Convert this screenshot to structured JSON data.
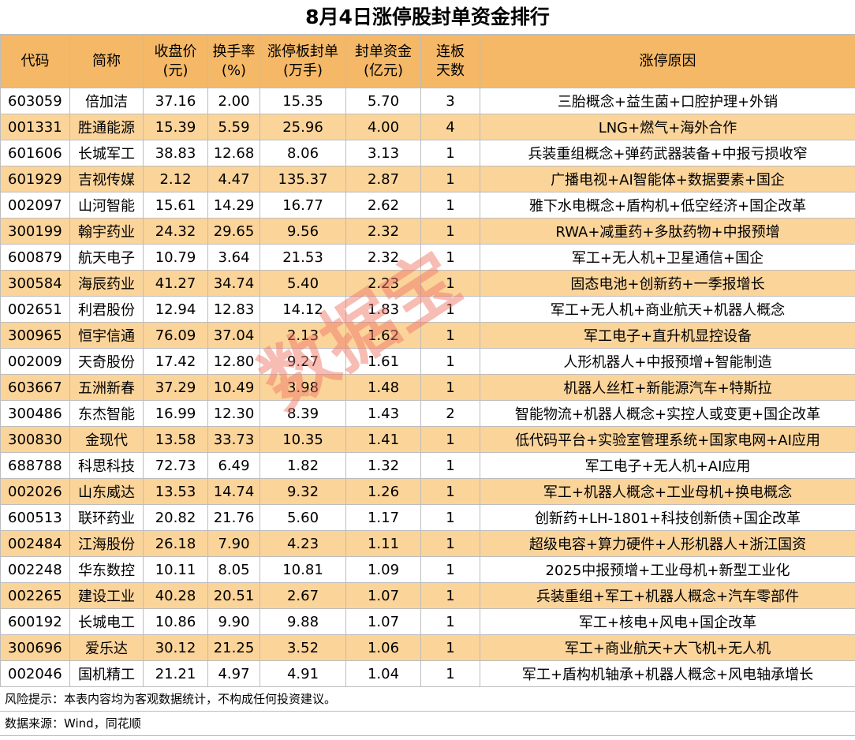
{
  "title": "8月4日涨停股封单资金排行",
  "headers": {
    "code": "代码",
    "name": "简称",
    "close_1": "收盘价",
    "close_2": "(元)",
    "turnover_1": "换手率",
    "turnover_2": "(%)",
    "seal_1": "涨停板封单",
    "seal_2": "(万手)",
    "fund_1": "封单资金",
    "fund_2": "(亿元)",
    "days_1": "连板",
    "days_2": "天数",
    "reason": "涨停原因"
  },
  "rows": [
    {
      "code": "603059",
      "name": "倍加洁",
      "close": "37.16",
      "turnover": "2.00",
      "seal": "15.35",
      "fund": "5.70",
      "days": "3",
      "reason": "三胎概念+益生菌+口腔护理+外销"
    },
    {
      "code": "001331",
      "name": "胜通能源",
      "close": "15.39",
      "turnover": "5.59",
      "seal": "25.96",
      "fund": "4.00",
      "days": "4",
      "reason": "LNG+燃气+海外合作"
    },
    {
      "code": "601606",
      "name": "长城军工",
      "close": "38.83",
      "turnover": "12.68",
      "seal": "8.06",
      "fund": "3.13",
      "days": "1",
      "reason": "兵装重组概念+弹药武器装备+中报亏损收窄"
    },
    {
      "code": "601929",
      "name": "吉视传媒",
      "close": "2.12",
      "turnover": "4.47",
      "seal": "135.37",
      "fund": "2.87",
      "days": "1",
      "reason": "广播电视+AI智能体+数据要素+国企"
    },
    {
      "code": "002097",
      "name": "山河智能",
      "close": "15.61",
      "turnover": "14.29",
      "seal": "16.77",
      "fund": "2.62",
      "days": "1",
      "reason": "雅下水电概念+盾构机+低空经济+国企改革"
    },
    {
      "code": "300199",
      "name": "翰宇药业",
      "close": "24.32",
      "turnover": "29.65",
      "seal": "9.56",
      "fund": "2.32",
      "days": "1",
      "reason": "RWA+减重药+多肽药物+中报预增"
    },
    {
      "code": "600879",
      "name": "航天电子",
      "close": "10.79",
      "turnover": "3.64",
      "seal": "21.53",
      "fund": "2.32",
      "days": "1",
      "reason": "军工+无人机+卫星通信+国企"
    },
    {
      "code": "300584",
      "name": "海辰药业",
      "close": "41.27",
      "turnover": "34.74",
      "seal": "5.40",
      "fund": "2.23",
      "days": "1",
      "reason": "固态电池+创新药+一季报增长"
    },
    {
      "code": "002651",
      "name": "利君股份",
      "close": "12.94",
      "turnover": "12.83",
      "seal": "14.12",
      "fund": "1.83",
      "days": "1",
      "reason": "军工+无人机+商业航天+机器人概念"
    },
    {
      "code": "300965",
      "name": "恒宇信通",
      "close": "76.09",
      "turnover": "37.04",
      "seal": "2.13",
      "fund": "1.62",
      "days": "1",
      "reason": "军工电子+直升机显控设备"
    },
    {
      "code": "002009",
      "name": "天奇股份",
      "close": "17.42",
      "turnover": "12.80",
      "seal": "9.27",
      "fund": "1.61",
      "days": "1",
      "reason": "人形机器人+中报预增+智能制造"
    },
    {
      "code": "603667",
      "name": "五洲新春",
      "close": "37.29",
      "turnover": "10.49",
      "seal": "3.98",
      "fund": "1.48",
      "days": "1",
      "reason": "机器人丝杠+新能源汽车+特斯拉"
    },
    {
      "code": "300486",
      "name": "东杰智能",
      "close": "16.99",
      "turnover": "12.30",
      "seal": "8.39",
      "fund": "1.43",
      "days": "2",
      "reason": "智能物流+机器人概念+实控人或变更+国企改革"
    },
    {
      "code": "300830",
      "name": "金现代",
      "close": "13.58",
      "turnover": "33.73",
      "seal": "10.35",
      "fund": "1.41",
      "days": "1",
      "reason": "低代码平台+实验室管理系统+国家电网+AI应用"
    },
    {
      "code": "688788",
      "name": "科思科技",
      "close": "72.73",
      "turnover": "6.49",
      "seal": "1.82",
      "fund": "1.32",
      "days": "1",
      "reason": "军工电子+无人机+AI应用"
    },
    {
      "code": "002026",
      "name": "山东威达",
      "close": "13.53",
      "turnover": "14.74",
      "seal": "9.32",
      "fund": "1.26",
      "days": "1",
      "reason": "军工+机器人概念+工业母机+换电概念"
    },
    {
      "code": "600513",
      "name": "联环药业",
      "close": "20.82",
      "turnover": "21.76",
      "seal": "5.60",
      "fund": "1.17",
      "days": "1",
      "reason": "创新药+LH-1801+科技创新债+国企改革"
    },
    {
      "code": "002484",
      "name": "江海股份",
      "close": "26.18",
      "turnover": "7.90",
      "seal": "4.23",
      "fund": "1.11",
      "days": "1",
      "reason": "超级电容+算力硬件+人形机器人+浙江国资"
    },
    {
      "code": "002248",
      "name": "华东数控",
      "close": "10.11",
      "turnover": "8.05",
      "seal": "10.81",
      "fund": "1.09",
      "days": "1",
      "reason": "2025中报预增+工业母机+新型工业化"
    },
    {
      "code": "002265",
      "name": "建设工业",
      "close": "40.28",
      "turnover": "20.51",
      "seal": "2.67",
      "fund": "1.07",
      "days": "1",
      "reason": "兵装重组+军工+机器人概念+汽车零部件"
    },
    {
      "code": "600192",
      "name": "长城电工",
      "close": "10.86",
      "turnover": "9.90",
      "seal": "9.88",
      "fund": "1.07",
      "days": "1",
      "reason": "军工+核电+风电+国企改革"
    },
    {
      "code": "300696",
      "name": "爱乐达",
      "close": "30.12",
      "turnover": "21.25",
      "seal": "3.52",
      "fund": "1.06",
      "days": "1",
      "reason": "军工+商业航天+大飞机+无人机"
    },
    {
      "code": "002046",
      "name": "国机精工",
      "close": "21.21",
      "turnover": "4.97",
      "seal": "4.91",
      "fund": "1.04",
      "days": "1",
      "reason": "军工+盾构机轴承+机器人概念+风电轴承增长"
    }
  ],
  "footer": {
    "risk": "风险提示：本表内容均为客观数据统计，不构成任何投资建议。",
    "source": "数据来源：Wind，同花顺"
  },
  "watermark": "数据宝",
  "colors": {
    "header_bg": "#f5b866",
    "stripe_bg": "#fbd49a",
    "watermark": "#f07a6a"
  }
}
